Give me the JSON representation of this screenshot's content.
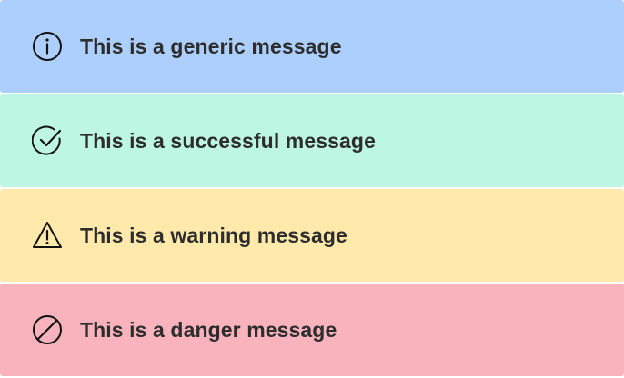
{
  "alerts": [
    {
      "type": "info",
      "icon": "info-circle-icon",
      "message": "This is a generic message",
      "color": "#adcffe"
    },
    {
      "type": "success",
      "icon": "check-circle-icon",
      "message": "This is a successful message",
      "color": "#bdf6e3"
    },
    {
      "type": "warning",
      "icon": "warning-triangle-icon",
      "message": "This is a warning message",
      "color": "#ffeaab"
    },
    {
      "type": "danger",
      "icon": "ban-circle-icon",
      "message": "This is a danger message",
      "color": "#f9b3bd"
    }
  ]
}
